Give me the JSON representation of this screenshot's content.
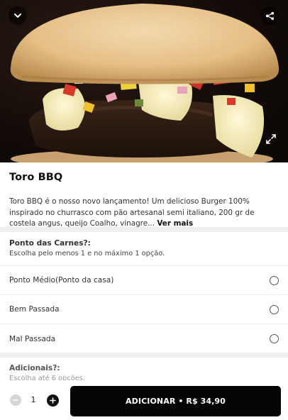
{
  "hero": {
    "back_icon": "chevron-down-icon",
    "share_icon": "share-icon",
    "expand_icon": "expand-icon"
  },
  "product": {
    "title": "Toro BBQ",
    "description": "Toro BBQ é o nosso novo lançamento! Um delicioso Burger 100% inspirado no churrasco com pão artesanal semi italiano, 200 gr de costela angus, queijo Coalho, vinagre...",
    "see_more": "Ver mais"
  },
  "group_meat": {
    "title": "Ponto das Carnes?:",
    "subtitle": "Escolha pelo menos 1 e no máximo 1 opção.",
    "options": [
      {
        "label": "Ponto Médio(Ponto da casa)"
      },
      {
        "label": "Bem Passada"
      },
      {
        "label": "Mal Passada"
      }
    ]
  },
  "group_extras": {
    "title": "Adicionais?:",
    "subtitle": "Escolha até 6 opções."
  },
  "footer": {
    "quantity": "1",
    "add_label": "ADICIONAR • R$ 34,90"
  }
}
